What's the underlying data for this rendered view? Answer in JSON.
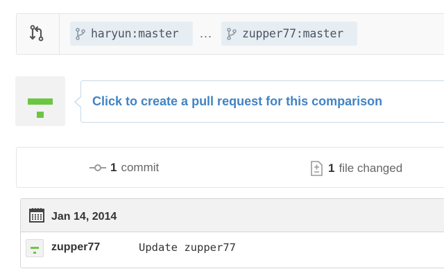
{
  "compare": {
    "base_branch": "haryun:master",
    "separator": "...",
    "head_branch": "zupper77:master"
  },
  "pull_request": {
    "prompt": "Click to create a pull request for this comparison"
  },
  "summary": {
    "commits_count": "1",
    "commits_label": "commit",
    "files_count": "1",
    "files_label": "file changed"
  },
  "commit_group": {
    "date": "Jan 14, 2014",
    "commits": [
      {
        "author": "zupper77",
        "message": "Update zupper77"
      }
    ]
  },
  "colors": {
    "link": "#4183c4",
    "identicon_green": "#6cc644",
    "pill_bg": "#e7eef3"
  },
  "icons": [
    "compare-icon",
    "branch-icon",
    "identicon-avatar",
    "commit-icon",
    "file-diff-icon",
    "calendar-icon"
  ]
}
